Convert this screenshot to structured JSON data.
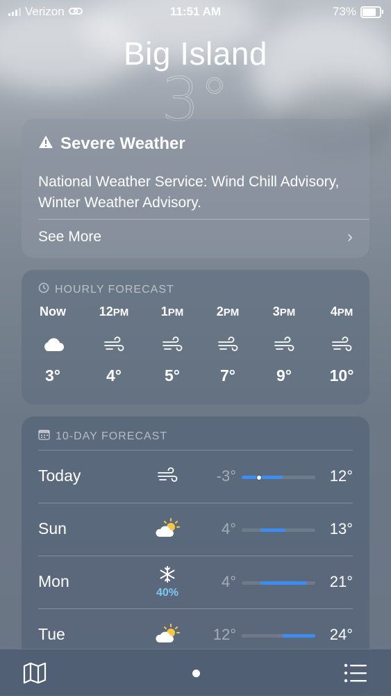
{
  "status_bar": {
    "carrier": "Verizon",
    "time": "11:51 AM",
    "battery_percent": "73%",
    "battery_level": 0.73,
    "icons": [
      "signal-bars-icon",
      "link-icon",
      "battery-icon"
    ]
  },
  "location": {
    "name": "Big Island",
    "temperature": "3°"
  },
  "severe": {
    "title": "Severe Weather",
    "icon": "warning-triangle-icon",
    "body": "National Weather Service: Wind Chill Advisory, Winter Weather Advisory.",
    "see_more": "See More",
    "chevron": "›"
  },
  "hourly": {
    "heading": "HOURLY FORECAST",
    "icon": "clock-icon",
    "items": [
      {
        "time": "Now",
        "suffix": "",
        "icon": "cloud-icon",
        "temp": "3°"
      },
      {
        "time": "12",
        "suffix": "PM",
        "icon": "wind-icon",
        "temp": "4°"
      },
      {
        "time": "1",
        "suffix": "PM",
        "icon": "wind-icon",
        "temp": "5°"
      },
      {
        "time": "2",
        "suffix": "PM",
        "icon": "wind-icon",
        "temp": "7°"
      },
      {
        "time": "3",
        "suffix": "PM",
        "icon": "wind-icon",
        "temp": "9°"
      },
      {
        "time": "4",
        "suffix": "PM",
        "icon": "wind-icon",
        "temp": "10°"
      }
    ]
  },
  "tenday": {
    "heading": "10-DAY FORECAST",
    "icon": "calendar-icon",
    "scale": {
      "min": -3,
      "max": 24
    },
    "days": [
      {
        "day": "Today",
        "icon": "wind-icon",
        "precip": "",
        "low": "-3°",
        "high": "12°",
        "low_value": -3,
        "high_value": 12,
        "current_value": 3
      },
      {
        "day": "Sun",
        "icon": "partly-sunny-icon",
        "precip": "",
        "low": "4°",
        "high": "13°",
        "low_value": 4,
        "high_value": 13
      },
      {
        "day": "Mon",
        "icon": "snowflake-icon",
        "precip": "40%",
        "low": "4°",
        "high": "21°",
        "low_value": 4,
        "high_value": 21
      },
      {
        "day": "Tue",
        "icon": "partly-sunny-icon",
        "precip": "",
        "low": "12°",
        "high": "24°",
        "low_value": 12,
        "high_value": 24
      }
    ]
  },
  "bottom_bar": {
    "left_icon": "map-icon",
    "right_icon": "list-icon",
    "page_indicator": "location-dot"
  },
  "colors": {
    "range_bar": "#3d8cf0",
    "precip_text": "#7cc8f4"
  }
}
